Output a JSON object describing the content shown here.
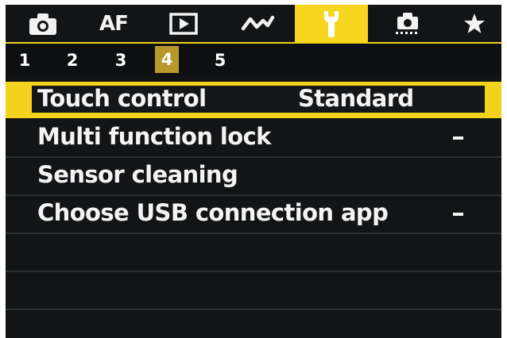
{
  "tabs": [
    {
      "name": "camera-icon",
      "label": ""
    },
    {
      "name": "af",
      "label": "AF"
    },
    {
      "name": "playback-icon",
      "label": ""
    },
    {
      "name": "custom-wave-icon",
      "label": ""
    },
    {
      "name": "wrench-icon",
      "label": "",
      "active": true
    },
    {
      "name": "custom-functions-icon",
      "label": ""
    },
    {
      "name": "star-icon",
      "label": ""
    }
  ],
  "pages": [
    "1",
    "2",
    "3",
    "4",
    "5"
  ],
  "active_page": "4",
  "menu": {
    "items": [
      {
        "label": "Touch control",
        "value": "Standard",
        "selected": true
      },
      {
        "label": "Multi function lock",
        "value": "-"
      },
      {
        "label": "Sensor cleaning",
        "value": ""
      },
      {
        "label": "Choose USB connection app",
        "value": "-"
      }
    ]
  },
  "colors": {
    "accent": "#f2d21c",
    "page_highlight": "#b8982a",
    "background": "#121416"
  }
}
